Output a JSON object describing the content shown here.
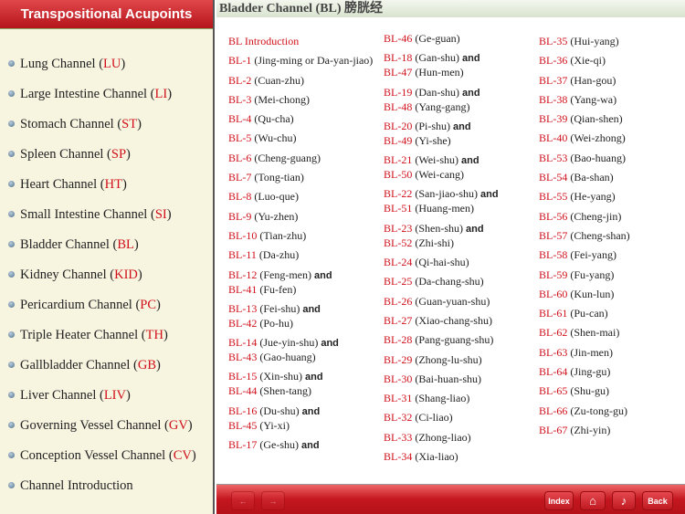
{
  "sidebar": {
    "title": "Transpositional Acupoints",
    "items": [
      {
        "name": "Lung Channel",
        "code": "LU"
      },
      {
        "name": "Large Intestine Channel",
        "code": "LI"
      },
      {
        "name": "Stomach Channel",
        "code": "ST"
      },
      {
        "name": "Spleen Channel",
        "code": "SP"
      },
      {
        "name": "Heart Channel",
        "code": "HT"
      },
      {
        "name": "Small Intestine Channel",
        "code": "SI"
      },
      {
        "name": "Bladder Channel",
        "code": "BL"
      },
      {
        "name": "Kidney Channel",
        "code": "KID"
      },
      {
        "name": "Pericardium Channel",
        "code": "PC"
      },
      {
        "name": "Triple Heater Channel",
        "code": "TH"
      },
      {
        "name": "Gallbladder Channel",
        "code": "GB"
      },
      {
        "name": "Liver Channel",
        "code": "LIV"
      },
      {
        "name": "Governing Vessel Channel",
        "code": "GV"
      },
      {
        "name": "Conception Vessel Channel",
        "code": "CV"
      },
      {
        "name": "Channel Introduction",
        "code": ""
      }
    ]
  },
  "header": {
    "title": "Bladder Channel (BL)  膀胱经"
  },
  "and_label": "and",
  "columns": [
    [
      [
        [
          "BL Introduction",
          ""
        ]
      ],
      [
        [
          "BL-1",
          "(Jing-ming or Da-yan-jiao)"
        ]
      ],
      [
        [
          "BL-2",
          "(Cuan-zhu)"
        ]
      ],
      [
        [
          "BL-3",
          "(Mei-chong)"
        ]
      ],
      [
        [
          "BL-4",
          "(Qu-cha)"
        ]
      ],
      [
        [
          "BL-5",
          "(Wu-chu)"
        ]
      ],
      [
        [
          "BL-6",
          "(Cheng-guang)"
        ]
      ],
      [
        [
          "BL-7",
          "(Tong-tian)"
        ]
      ],
      [
        [
          "BL-8",
          "(Luo-que)"
        ]
      ],
      [
        [
          "BL-9",
          "(Yu-zhen)"
        ]
      ],
      [
        [
          "BL-10",
          "(Tian-zhu)"
        ]
      ],
      [
        [
          "BL-11",
          "(Da-zhu)"
        ]
      ],
      [
        [
          "BL-12",
          "(Feng-men)"
        ],
        [
          "BL-41",
          "(Fu-fen)"
        ]
      ],
      [
        [
          "BL-13",
          "(Fei-shu)"
        ],
        [
          "BL-42",
          "(Po-hu)"
        ]
      ],
      [
        [
          "BL-14",
          "(Jue-yin-shu)"
        ],
        [
          "BL-43",
          "(Gao-huang)"
        ]
      ],
      [
        [
          "BL-15",
          "(Xin-shu)"
        ],
        [
          "BL-44",
          "(Shen-tang)"
        ]
      ],
      [
        [
          "BL-16",
          "(Du-shu)"
        ],
        [
          "BL-45",
          "(Yi-xi)"
        ]
      ],
      [
        [
          "BL-17",
          "(Ge-shu)"
        ],
        [
          "",
          ""
        ]
      ]
    ],
    [
      [
        [
          "BL-46",
          "(Ge-guan)"
        ]
      ],
      [
        [
          "BL-18",
          "(Gan-shu)"
        ],
        [
          "BL-47",
          "(Hun-men)"
        ]
      ],
      [
        [
          "BL-19",
          "(Dan-shu)"
        ],
        [
          "BL-48",
          "(Yang-gang)"
        ]
      ],
      [
        [
          "BL-20",
          "(Pi-shu)"
        ],
        [
          "BL-49",
          "(Yi-she)"
        ]
      ],
      [
        [
          "BL-21",
          "(Wei-shu)"
        ],
        [
          "BL-50",
          "(Wei-cang)"
        ]
      ],
      [
        [
          "BL-22",
          "(San-jiao-shu)"
        ],
        [
          "BL-51",
          "(Huang-men)"
        ]
      ],
      [
        [
          "BL-23",
          "(Shen-shu)"
        ],
        [
          "BL-52",
          "(Zhi-shi)"
        ]
      ],
      [
        [
          "BL-24",
          "(Qi-hai-shu)"
        ]
      ],
      [
        [
          "BL-25",
          "(Da-chang-shu)"
        ]
      ],
      [
        [
          "BL-26",
          "(Guan-yuan-shu)"
        ]
      ],
      [
        [
          "BL-27",
          "(Xiao-chang-shu)"
        ]
      ],
      [
        [
          "BL-28",
          "(Pang-guang-shu)"
        ]
      ],
      [
        [
          "BL-29",
          "(Zhong-lu-shu)"
        ]
      ],
      [
        [
          "BL-30",
          "(Bai-huan-shu)"
        ]
      ],
      [
        [
          "BL-31",
          "(Shang-liao)"
        ]
      ],
      [
        [
          "BL-32",
          "(Ci-liao)"
        ]
      ],
      [
        [
          "BL-33",
          "(Zhong-liao)"
        ]
      ],
      [
        [
          "BL-34",
          "(Xia-liao)"
        ]
      ]
    ],
    [
      [
        [
          "BL-35",
          "(Hui-yang)"
        ]
      ],
      [
        [
          "BL-36",
          "(Xie-qi)"
        ]
      ],
      [
        [
          "BL-37",
          "(Han-gou)"
        ]
      ],
      [
        [
          "BL-38",
          "(Yang-wa)"
        ]
      ],
      [
        [
          "BL-39",
          "(Qian-shen)"
        ]
      ],
      [
        [
          "BL-40",
          "(Wei-zhong)"
        ]
      ],
      [
        [
          "BL-53",
          "(Bao-huang)"
        ]
      ],
      [
        [
          "BL-54",
          "(Ba-shan)"
        ]
      ],
      [
        [
          "BL-55",
          "(He-yang)"
        ]
      ],
      [
        [
          "BL-56",
          "(Cheng-jin)"
        ]
      ],
      [
        [
          "BL-57",
          "(Cheng-shan)"
        ]
      ],
      [
        [
          "BL-58",
          "(Fei-yang)"
        ]
      ],
      [
        [
          "BL-59",
          "(Fu-yang)"
        ]
      ],
      [
        [
          "BL-60",
          "(Kun-lun)"
        ]
      ],
      [
        [
          "BL-61",
          "(Pu-can)"
        ]
      ],
      [
        [
          "BL-62",
          "(Shen-mai)"
        ]
      ],
      [
        [
          "BL-63",
          "(Jin-men)"
        ]
      ],
      [
        [
          "BL-64",
          "(Jing-gu)"
        ]
      ],
      [
        [
          "BL-65",
          "(Shu-gu)"
        ]
      ],
      [
        [
          "BL-66",
          "(Zu-tong-gu)"
        ]
      ],
      [
        [
          "BL-67",
          "(Zhi-yin)"
        ]
      ]
    ]
  ],
  "toolbar": {
    "index_label": "Index",
    "back_label": "Back",
    "prev_icon": "arrow-left-icon",
    "next_icon": "arrow-right-icon",
    "home_icon": "home-icon",
    "music_icon": "music-note-icon"
  },
  "colors": {
    "accent": "#d0111b",
    "sidebar_bg": "#f7f4e0"
  }
}
